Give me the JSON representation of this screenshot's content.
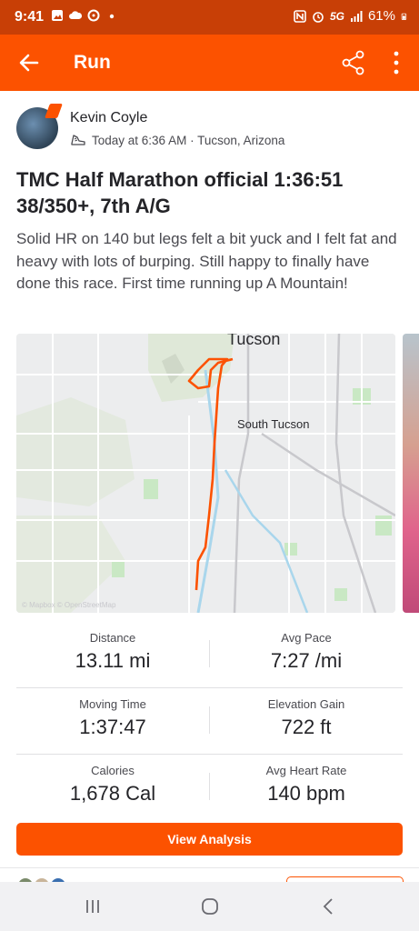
{
  "status_bar": {
    "time": "9:41",
    "network": "5G",
    "battery": "61%",
    "left_icons": [
      "image-icon",
      "cloud-icon",
      "sync-icon",
      "dot-icon"
    ],
    "right_icons": [
      "nfc-icon",
      "alarm-icon",
      "signal-icon",
      "battery-icon"
    ]
  },
  "app_bar": {
    "title": "Run",
    "back_icon": "arrow-left-icon",
    "share_icon": "share-icon",
    "more_icon": "more-vertical-icon"
  },
  "activity": {
    "athlete_name": "Kevin Coyle",
    "meta": "Today at 6:36 AM · Tucson, Arizona",
    "title": "TMC Half Marathon official 1:36:51 38/350+, 7th A/G",
    "description": "Solid HR on 140 but legs felt a bit yuck and I felt fat and heavy with lots of burping. Still happy to finally have done this race. First time running up A Mountain!"
  },
  "map": {
    "label_city": "Tucson",
    "label_area": "South Tucson",
    "attribution": "© Mapbox © OpenStreetMap",
    "route_color": "#fc5200"
  },
  "stats": [
    {
      "label": "Distance",
      "value": "13.11 mi"
    },
    {
      "label": "Avg Pace",
      "value": "7:27 /mi"
    },
    {
      "label": "Moving Time",
      "value": "1:37:47"
    },
    {
      "label": "Elevation Gain",
      "value": "722 ft"
    },
    {
      "label": "Calories",
      "value": "1,678 Cal"
    },
    {
      "label": "Avg Heart Rate",
      "value": "140 bpm"
    }
  ],
  "actions": {
    "view_analysis": "View Analysis"
  },
  "colors": {
    "brand": "#fc5200",
    "status_bar": "#c83f06"
  }
}
